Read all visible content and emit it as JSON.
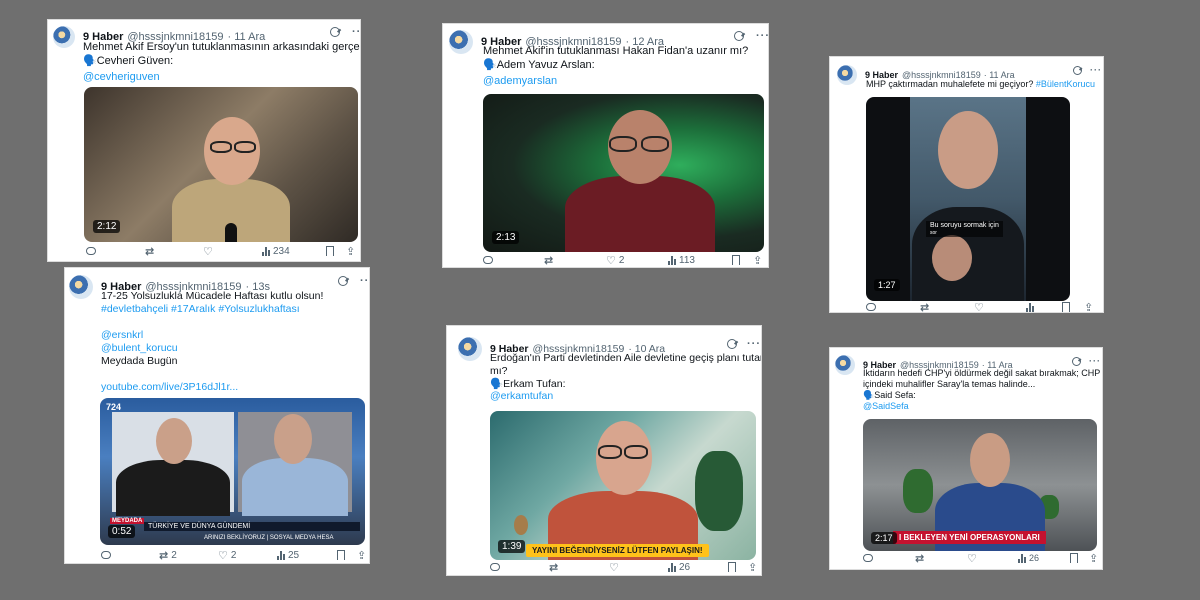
{
  "account": {
    "name": "9 Haber",
    "handle": "@hsssjnkmni18159"
  },
  "icons": [
    "grok-icon",
    "more-icon",
    "reply-icon",
    "retweet-icon",
    "like-icon",
    "views-icon",
    "bookmark-icon",
    "share-icon"
  ],
  "colors": {
    "background": "#6f6f6f",
    "card": "#ffffff",
    "link": "#1d9bf0",
    "muted": "#536471",
    "overlay_yellow": "#ffc21a",
    "overlay_red": "#c4122f"
  },
  "tweets": [
    {
      "date": "· 11 Ara",
      "lines": [
        "Mehmet Akif Ersoy'un tutuklanmasının arkasındaki gerçek?",
        "🗣️Cevheri Güven:"
      ],
      "mention": "@cevheriguven",
      "duration": "2:12",
      "stats": {
        "likes": "",
        "views": "234"
      }
    },
    {
      "date": "· 12 Ara",
      "lines": [
        "Mehmet Akif'in tutuklanması Hakan Fidan'a uzanır mı?",
        "🗣️Adem Yavuz Arslan:"
      ],
      "mention": "@ademyarslan",
      "duration": "2:13",
      "stats": {
        "likes": "2",
        "views": "113"
      }
    },
    {
      "date": "· 11 Ara",
      "lines": [
        "MHP çaktırmadan muhalefete mi geçiyor?"
      ],
      "hashtag": "#BülentKorucu",
      "duration": "1:27",
      "caption": "Bu soruyu sormak için",
      "caption_small": "sor",
      "stats": {}
    },
    {
      "date": "· 13s",
      "lines": [
        "17-25 Yolsuzlukla Mücadele Haftası kutlu olsun!"
      ],
      "hashtags": "#devletbahçeli #17Aralık #Yolsuzlukhaftası",
      "mentions": [
        "@ersnkrl",
        "@bulent_korucu"
      ],
      "extra": "Meydada Bugün",
      "link": "youtube.com/live/3P16dJl1r...",
      "duration": "0:52",
      "channel": "724",
      "program": "MEYDADA",
      "ticker": "TÜRKİYE VE DÜNYA GÜNDEMİ",
      "ticker2": "ARINIZI BEKLİYORUZ | SOSYAL MEDYA HESA",
      "stats": {
        "retweets": "2",
        "likes": "2",
        "views": "25"
      }
    },
    {
      "date": "· 10 Ara",
      "lines": [
        "Erdoğan'ın Parti devletinden Aile devletine geçiş planı tutar",
        "mı?",
        "🗣️Erkam Tufan:"
      ],
      "mention": "@erkamtufan",
      "duration": "1:39",
      "banner": "YAYINI BEĞENDİYSENİZ LÜTFEN PAYLAŞIN!",
      "stats": {
        "views": "26"
      }
    },
    {
      "date": "· 11 Ara",
      "lines": [
        "İktidarın hedefi CHP'yi öldürmek değil sakat bırakmak; CHP",
        "içindeki muhalifler Saray'la temas halinde...",
        "🗣️Said Sefa:"
      ],
      "mention": "@SaidSefa",
      "duration": "2:17",
      "banner": "I BEKLEYEN YENİ OPERASYONLARI",
      "stats": {
        "views": "26"
      }
    }
  ]
}
